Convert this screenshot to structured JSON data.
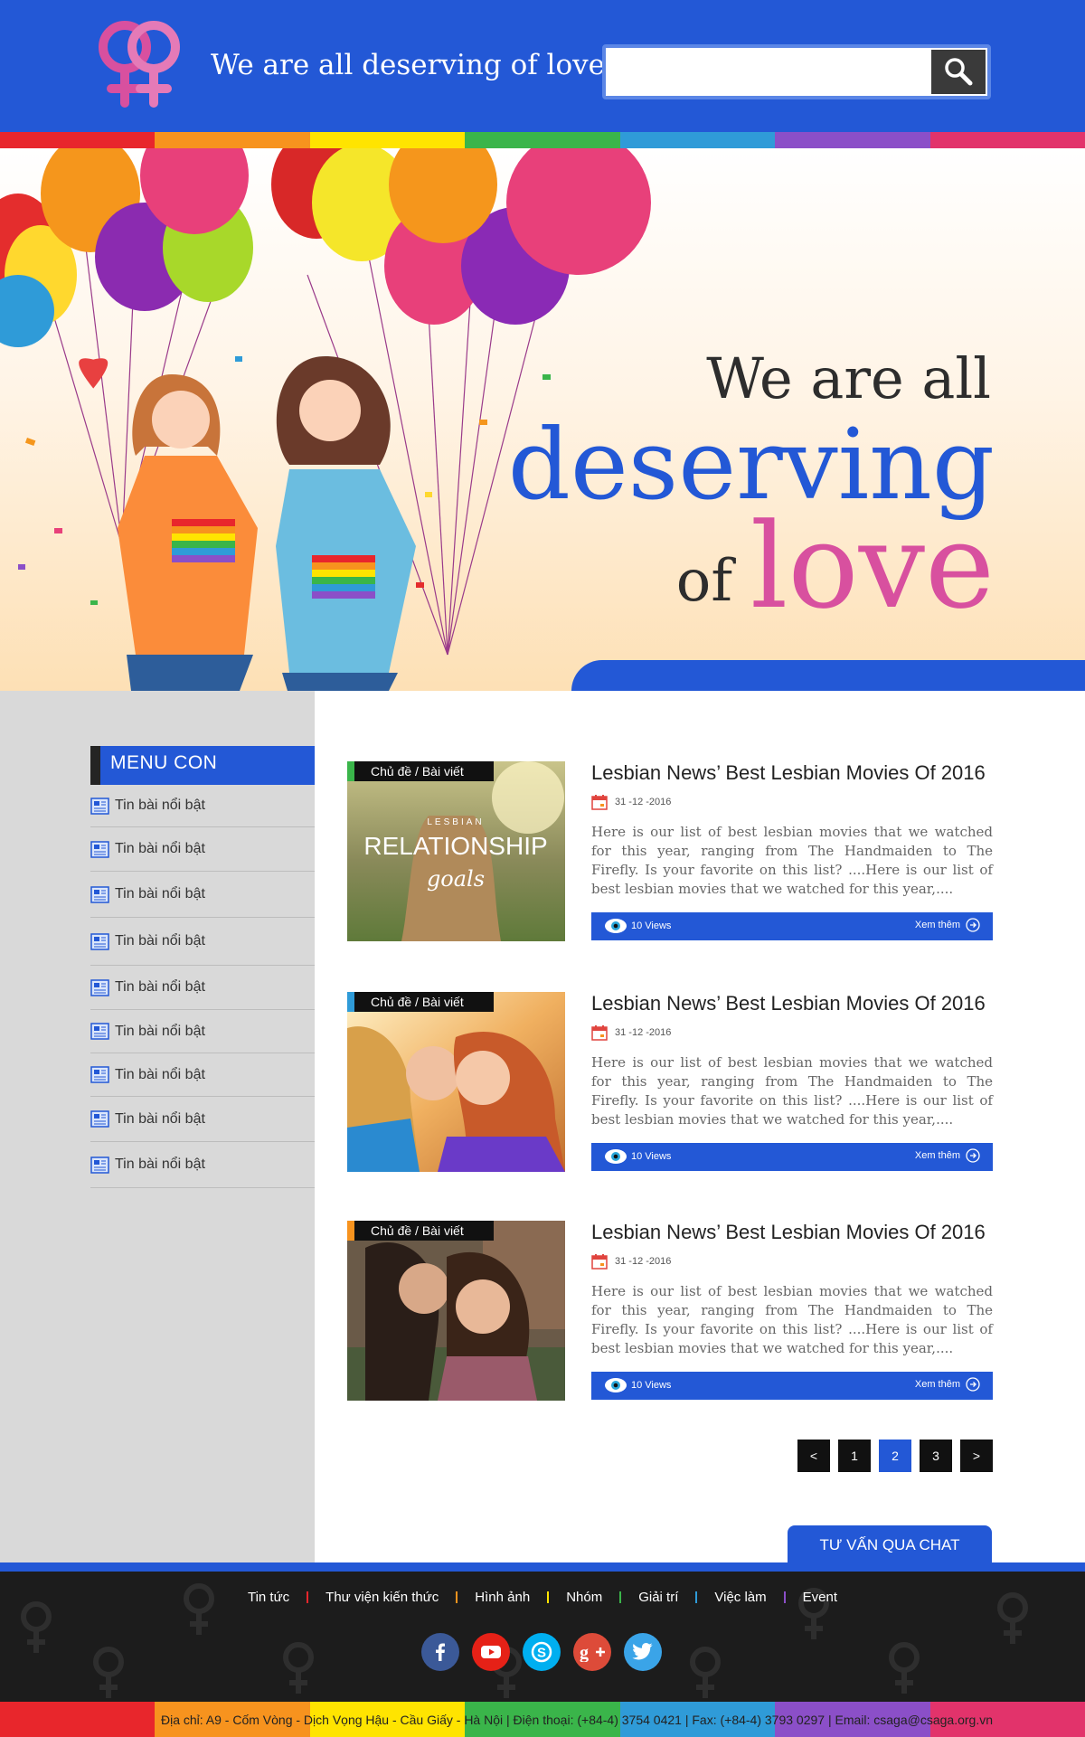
{
  "brand": {
    "name_light": "We are",
    "name_bold": "all deserving of love"
  },
  "search": {
    "placeholder": "",
    "value": ""
  },
  "colors": {
    "primary": "#2358d6",
    "pink": "#d8509f",
    "rainbow": [
      "#e8262c",
      "#f7931e",
      "#ffe400",
      "#3ab54a",
      "#2f9bd8",
      "#8b4fc8",
      "#e2336b"
    ]
  },
  "hero": {
    "line1": "We are all",
    "line2": "deserving",
    "line3_small": "of",
    "line3_big": "love"
  },
  "sidebar": {
    "title": "MENU CON",
    "items": [
      {
        "label": "Tin bài nổi bật",
        "icon": "news-icon"
      },
      {
        "label": "Tin bài nổi bật",
        "icon": "news-icon"
      },
      {
        "label": "Tin bài nổi bật",
        "icon": "news-icon"
      },
      {
        "label": "Tin bài nổi bật",
        "icon": "news-icon"
      },
      {
        "label": "Tin bài nổi bật",
        "icon": "news-icon"
      },
      {
        "label": "Tin bài nổi bật",
        "icon": "news-icon"
      },
      {
        "label": "Tin bài nổi bật",
        "icon": "news-icon"
      },
      {
        "label": "Tin bài nổi bật",
        "icon": "news-icon"
      },
      {
        "label": "Tin bài nổi bật",
        "icon": "news-icon"
      }
    ]
  },
  "posts": [
    {
      "category": "Chủ đề / Bài viết",
      "category_color": "#3ab54a",
      "thumb_small": "LESBIAN",
      "thumb_big": "RELATIONSHIP",
      "thumb_script": "goals",
      "title": "Lesbian News’ Best Lesbian Movies Of 2016",
      "date": "31 -12 -2016",
      "excerpt": "Here is our list of best lesbian movies that we watched for this year, ranging from The Handmaiden to The Firefly. Is your favorite on this list? ....Here is our list of best lesbian movies that we watched for this year,....",
      "views": "10 Views",
      "more": "Xem thêm"
    },
    {
      "category": "Chủ đề / Bài viết",
      "category_color": "#2f9bd8",
      "title": "Lesbian News’ Best Lesbian Movies Of 2016",
      "date": "31 -12 -2016",
      "excerpt": "Here is our list of best lesbian movies that we watched for this year, ranging from The Handmaiden to The Firefly. Is your favorite on this list? ....Here is our list of best lesbian movies that we watched for this year,....",
      "views": "10 Views",
      "more": "Xem thêm"
    },
    {
      "category": "Chủ đề / Bài viết",
      "category_color": "#f7931e",
      "title": "Lesbian News’ Best Lesbian Movies Of 2016",
      "date": "31 -12 -2016",
      "excerpt": "Here is our list of best lesbian movies that we watched for this year, ranging from The Handmaiden to The Firefly. Is your favorite on this list? ....Here is our list of best lesbian movies that we watched for this year,....",
      "views": "10 Views",
      "more": "Xem thêm"
    }
  ],
  "pagination": {
    "prev": "<",
    "pages": [
      "1",
      "2",
      "3"
    ],
    "current": "2",
    "next": ">"
  },
  "chat_button": "TƯ VẤN QUA CHAT",
  "footer": {
    "nav": [
      "Tin tức",
      "Thư viện kiến thức",
      "Hình ảnh",
      "Nhóm",
      "Giải trí",
      "Việc làm",
      "Event"
    ],
    "social": [
      {
        "name": "facebook-icon",
        "color": "#3b5998"
      },
      {
        "name": "youtube-icon",
        "color": "#e62117"
      },
      {
        "name": "skype-icon",
        "color": "#00aff0"
      },
      {
        "name": "google-plus-icon",
        "color": "#dd4b39"
      },
      {
        "name": "twitter-icon",
        "color": "#3aa4e8"
      }
    ],
    "address": "Địa chỉ: A9 - Cốm Vòng - Dịch Vọng Hậu - Cầu Giấy - Hà Nội  |  Điện thoại: (+84-4) 3754 0421  |  Fax: (+84-4) 3793 0297  |  Email: csaga@csaga.org.vn"
  }
}
